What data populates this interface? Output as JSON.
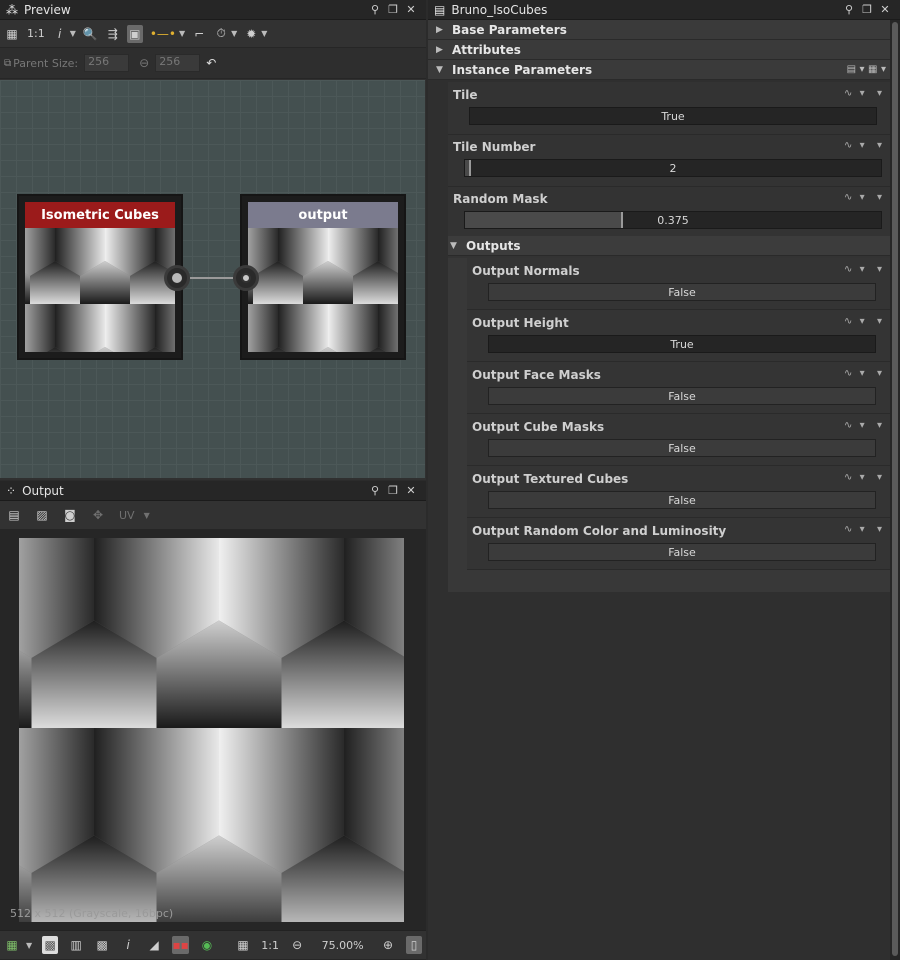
{
  "preview_panel": {
    "title": "Preview",
    "toolbar": {
      "ratio_label": "1:1",
      "info_label": "i"
    },
    "parent_size_label": "Parent Size:",
    "width_value": "256",
    "height_value": "256"
  },
  "graph": {
    "nodes": [
      {
        "title": "Isometric Cubes",
        "header_color": "#9b1b1b"
      },
      {
        "title": "output",
        "header_color": "#7a7a8c"
      }
    ]
  },
  "output_panel": {
    "title": "Output",
    "toolbar": {
      "uv_label": "UV"
    },
    "image_info": "512 x 512 (Grayscale, 16bpc)",
    "bottom_bar": {
      "ratio_label": "1:1",
      "zoom": "75.00%",
      "info_label": "i"
    }
  },
  "properties_panel": {
    "title": "Bruno_IsoCubes",
    "sections": {
      "base": "Base Parameters",
      "attributes": "Attributes",
      "instance": "Instance Parameters",
      "outputs": "Outputs"
    },
    "params": {
      "tile": {
        "label": "Tile",
        "value": "True"
      },
      "tile_number": {
        "label": "Tile Number",
        "value": "2",
        "fraction": 0.01
      },
      "random_mask": {
        "label": "Random Mask",
        "value": "0.375",
        "fraction": 0.375
      }
    },
    "outputs": [
      {
        "label": "Output Normals",
        "value": "False"
      },
      {
        "label": "Output Height",
        "value": "True"
      },
      {
        "label": "Output Face Masks",
        "value": "False"
      },
      {
        "label": "Output Cube Masks",
        "value": "False"
      },
      {
        "label": "Output Textured Cubes",
        "value": "False"
      },
      {
        "label": "Output Random Color and Luminosity",
        "value": "False"
      }
    ]
  }
}
